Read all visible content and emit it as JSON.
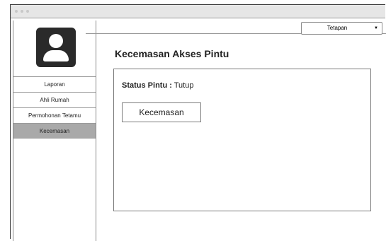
{
  "settings": {
    "label": "Tetapan"
  },
  "sidebar": {
    "items": [
      {
        "label": "Laporan"
      },
      {
        "label": "Ahli Rumah"
      },
      {
        "label": "Permohonan Tetamu"
      },
      {
        "label": "Kecemasan"
      }
    ],
    "active_index": 3
  },
  "main": {
    "title": "Kecemasan Akses Pintu",
    "status_key": "Status Pintu :",
    "status_value": "Tutup",
    "emergency_button": "Kecemasan"
  },
  "colors": {
    "avatar_bg": "#2a2a2a",
    "active_nav_bg": "#a9a9a9"
  }
}
